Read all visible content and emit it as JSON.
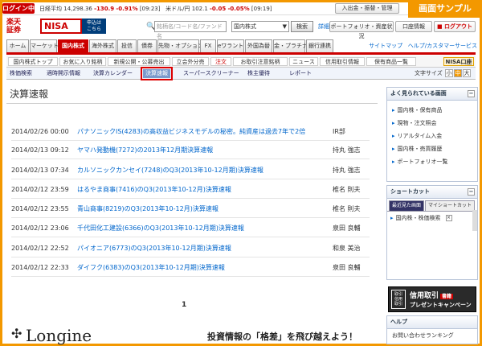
{
  "topbar": {
    "login_label": "ログイン中",
    "nikkei_label": "日経平均",
    "nikkei_value": "14,298.36",
    "nikkei_change": "-130.9",
    "nikkei_pct": "-0.91%",
    "nikkei_time": "[09:23]",
    "usdjpy_label": "米ドル/円",
    "usdjpy_value": "102.1",
    "usdjpy_change": "-0.05",
    "usdjpy_pct": "-0.05%",
    "usdjpy_time": "[09:19]",
    "deposit_button": "入出金・振替・管理",
    "sample_badge": "画面サンプル"
  },
  "logo": {
    "rakuten_top": "楽天",
    "rakuten_bottom": "証券",
    "nisa": "NISA",
    "nisa_apply_1": "申込は",
    "nisa_apply_2": "こちら"
  },
  "search": {
    "placeholder": "銘柄名/コード名/ファンド名",
    "type_value": "国内株式",
    "button": "検索",
    "detail_link": "詳細"
  },
  "util": {
    "portfolio": "ポートフォリオ・資産状況",
    "account": "口座情報",
    "logout": "ログアウト"
  },
  "mainnav": {
    "tabs": [
      "ホーム",
      "マーケット",
      "国内株式",
      "海外株式",
      "投信",
      "債券",
      "先物・オプション",
      "FX",
      "eワラント",
      "外国為替",
      "金・プラチナ",
      "銀行連携"
    ],
    "sitemap": "サイトマップ",
    "help": "ヘルプ/カスタマーサービス"
  },
  "subnav1": {
    "items": [
      "国内株式トップ",
      "お気に入り銘柄",
      "新規公開・公募売出",
      "立会外分売",
      "注文",
      "お取引注意銘柄",
      "ニュース",
      "信用取引情報",
      "保有商品一覧"
    ],
    "nisa_tag": "NISA口座"
  },
  "subnav2": {
    "items": [
      "株価検索",
      "適時開示情報",
      "決算カレンダー",
      "決算速報",
      "スーパースクリーナー",
      "株主優待",
      "レポート"
    ],
    "fontsize_label": "文字サイズ",
    "fontsize_options": [
      "小",
      "中",
      "大"
    ]
  },
  "main": {
    "title": "決算速報",
    "rows": [
      {
        "date": "2014/02/26 00:00",
        "headline": "パナソニックIS(4283)の高収益ビジネスモデルの秘密。純資産は過去7年で2倍",
        "source": "IR部"
      },
      {
        "date": "2014/02/13 09:12",
        "headline": "ヤマハ発動機(7272)の2013年12月期決算速報",
        "source": "持丸 強志"
      },
      {
        "date": "2014/02/13 07:34",
        "headline": "カルソニックカンセイ(7248)のQ3(2013年10-12月期)決算速報",
        "source": "持丸 強志"
      },
      {
        "date": "2014/02/12 23:59",
        "headline": "はるやま商事(7416)のQ3(2013年10-12月)決算速報",
        "source": "椎名 則夫"
      },
      {
        "date": "2014/02/12 23:55",
        "headline": "青山商事(8219)のQ3(2013年10-12月)決算速報",
        "source": "椎名 則夫"
      },
      {
        "date": "2014/02/12 23:06",
        "headline": "千代田化工建設(6366)のQ3(2013年10-12月期)決算速報",
        "source": "泉田 良輔"
      },
      {
        "date": "2014/02/12 22:52",
        "headline": "パイオニア(6773)のQ3(2013年10-12月期)決算速報",
        "source": "和泉 美治"
      },
      {
        "date": "2014/02/12 22:33",
        "headline": "ダイフク(6383)のQ3(2013年10-12月期)決算速報",
        "source": "泉田 良輔"
      }
    ],
    "pager_current": "1",
    "longine": "Longine",
    "tagline": "投資情報の「格差」を飛び越えよう！"
  },
  "sidebar": {
    "recent_title": "よく見られている画面",
    "recent_items": [
      "国内株・保有商品",
      "現物・注文照会",
      "リアルタイム入金",
      "国内株・売買履歴",
      "ポートフォリオ一覧"
    ],
    "shortcut_title": "ショートカット",
    "shortcut_tabs": [
      "最近見た画面",
      "マイショートカット"
    ],
    "shortcut_items": [
      "国内株・株価検索"
    ],
    "banner_icon": "取引 信用 取引",
    "banner_title": "信用取引",
    "banner_badge": "書籍",
    "banner_sub": "プレゼントキャンペーン",
    "help_title": "ヘルプ",
    "help_items": [
      "お問い合わせランキング"
    ]
  }
}
